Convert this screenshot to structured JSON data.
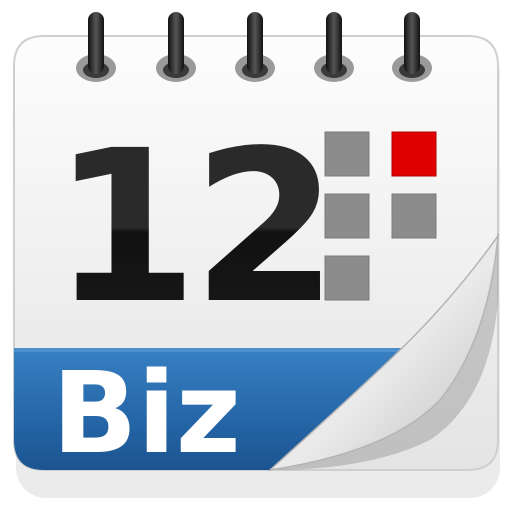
{
  "icon": {
    "name": "business-calendar-app-icon",
    "day_number": "12",
    "brand_label": "Biz",
    "colors": {
      "page": "#f2f2f2",
      "band_top": "#2f78b9",
      "band_bottom": "#1a4f89",
      "digits": "#1a1a1a",
      "grid_square": "#8c8c8c",
      "highlight_square": "#e00000",
      "label": "#ffffff",
      "ring": "#2b2b2b"
    },
    "grid": {
      "rows": 3,
      "columns": 2,
      "highlighted_cell": [
        0,
        1
      ],
      "empty_cells": [
        [
          2,
          1
        ]
      ]
    },
    "binding_rings": 5
  }
}
